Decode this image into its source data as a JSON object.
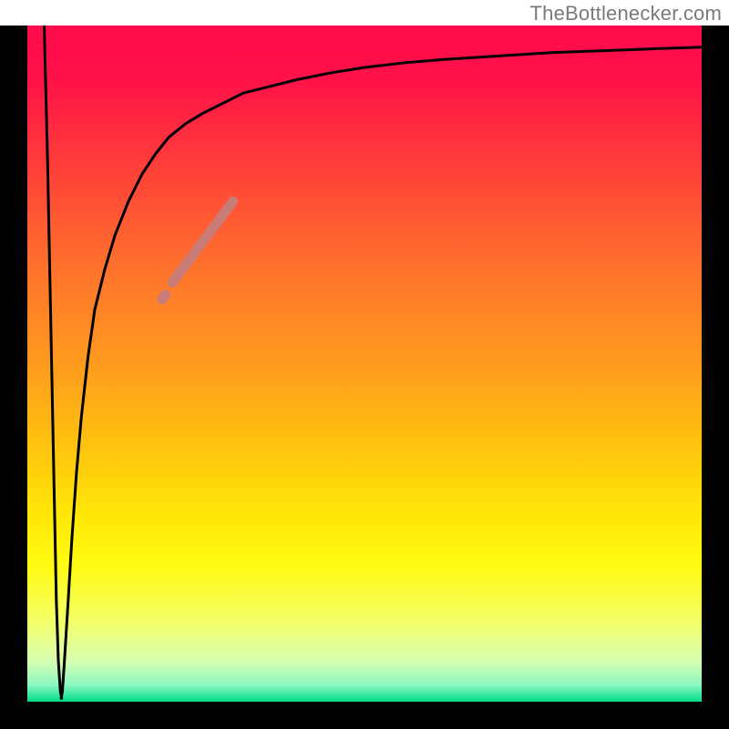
{
  "attribution": "TheBottlenecker.com",
  "chart_data": {
    "type": "line",
    "title": "",
    "xlabel": "",
    "ylabel": "",
    "xlim": [
      0,
      100
    ],
    "ylim": [
      0,
      100
    ],
    "grid": false,
    "legend": false,
    "background_gradient_stops": [
      {
        "offset": 0.0,
        "color": "#ff0b4c"
      },
      {
        "offset": 0.08,
        "color": "#ff1249"
      },
      {
        "offset": 0.2,
        "color": "#ff3b3a"
      },
      {
        "offset": 0.35,
        "color": "#ff6f2d"
      },
      {
        "offset": 0.5,
        "color": "#ff9b1e"
      },
      {
        "offset": 0.62,
        "color": "#ffc20f"
      },
      {
        "offset": 0.72,
        "color": "#ffe607"
      },
      {
        "offset": 0.8,
        "color": "#fffb12"
      },
      {
        "offset": 0.88,
        "color": "#f4ff67"
      },
      {
        "offset": 0.94,
        "color": "#d7ffb0"
      },
      {
        "offset": 0.975,
        "color": "#8cf7c1"
      },
      {
        "offset": 1.0,
        "color": "#00dd88"
      }
    ],
    "frame": {
      "color": "#000000",
      "thickness_px": 30
    },
    "series": [
      {
        "name": "bottleneck-curve",
        "stroke": "#000000",
        "stroke_width_px": 3,
        "x": [
          2.5,
          3.0,
          3.5,
          4.0,
          4.3,
          4.6,
          4.9,
          5.1,
          5.0,
          5.2,
          5.5,
          6.0,
          6.6,
          7.3,
          8.0,
          9.0,
          10.0,
          11.5,
          13.0,
          15.0,
          17.0,
          19.0,
          21.0,
          23.5,
          26.0,
          29.0,
          32.0,
          36.0,
          40.0,
          45.0,
          50.0,
          56.0,
          62.0,
          70.0,
          78.0,
          86.0,
          94.0,
          100.0
        ],
        "y": [
          100.0,
          80.0,
          55.0,
          30.0,
          15.0,
          6.0,
          1.5,
          0.5,
          0.5,
          1.5,
          6.0,
          14.0,
          24.0,
          34.0,
          42.0,
          51.0,
          58.0,
          64.0,
          69.0,
          74.0,
          78.0,
          81.0,
          83.5,
          85.5,
          87.0,
          88.5,
          90.0,
          91.0,
          92.0,
          93.0,
          93.8,
          94.5,
          95.0,
          95.5,
          96.0,
          96.3,
          96.6,
          96.8
        ]
      },
      {
        "name": "highlight-segment",
        "stroke": "#c97b76",
        "stroke_width_px": 11,
        "linecap": "round",
        "x": [
          21.5,
          23.0,
          24.5,
          26.0,
          27.5,
          29.0,
          30.5
        ],
        "y": [
          62.0,
          64.0,
          66.0,
          68.0,
          70.0,
          72.0,
          74.0
        ]
      },
      {
        "name": "highlight-dot",
        "stroke": "#c97b76",
        "stroke_width_px": 11,
        "linecap": "round",
        "x": [
          20.0,
          20.5
        ],
        "y": [
          59.5,
          60.2
        ]
      }
    ]
  }
}
